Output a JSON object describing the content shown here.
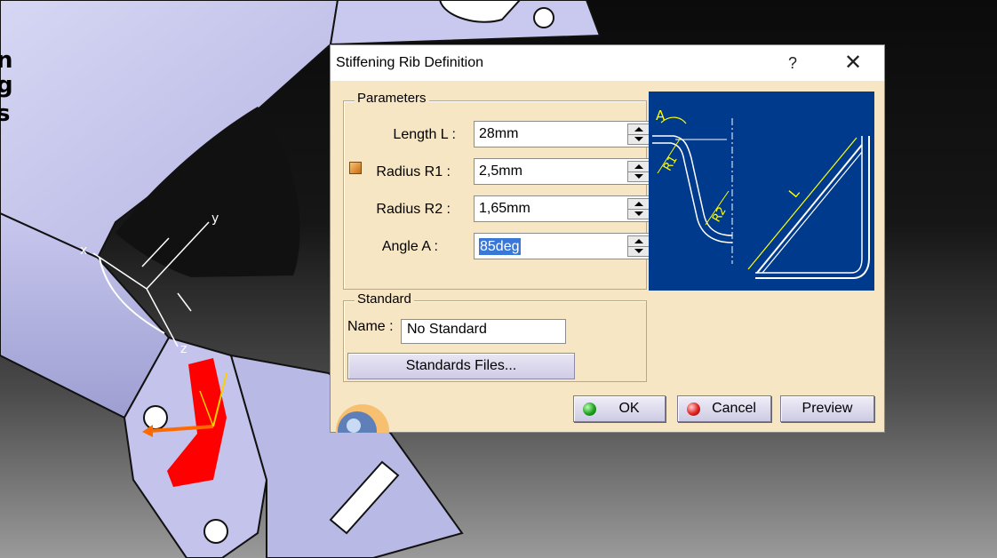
{
  "background": {
    "left_text_fragments": [
      "n",
      "g",
      "s"
    ]
  },
  "dialog": {
    "title": "Stiffening Rib Definition",
    "help_label": "?",
    "close_label": "✕",
    "parameters": {
      "legend": "Parameters",
      "length": {
        "label": "Length L :",
        "value": "28mm"
      },
      "radius_r1": {
        "label": "Radius R1 :",
        "value": "2,5mm"
      },
      "radius_r2": {
        "label": "Radius R2 :",
        "value": "1,65mm"
      },
      "angle": {
        "label": "Angle A :",
        "value": "85deg"
      }
    },
    "diagram_labels": {
      "a": "A",
      "r1": "R1",
      "r2": "R2",
      "l": "L"
    },
    "standard": {
      "legend": "Standard",
      "name_label": "Name :",
      "name_value": "No Standard",
      "files_button": "Standards Files..."
    },
    "buttons": {
      "ok": "OK",
      "cancel": "Cancel",
      "preview": "Preview"
    }
  },
  "colors": {
    "dialog_bg": "#f7e6c4",
    "diagram_bg": "#003a8c",
    "part_face": "#b8b8e8",
    "highlight_red": "#ff0000"
  }
}
